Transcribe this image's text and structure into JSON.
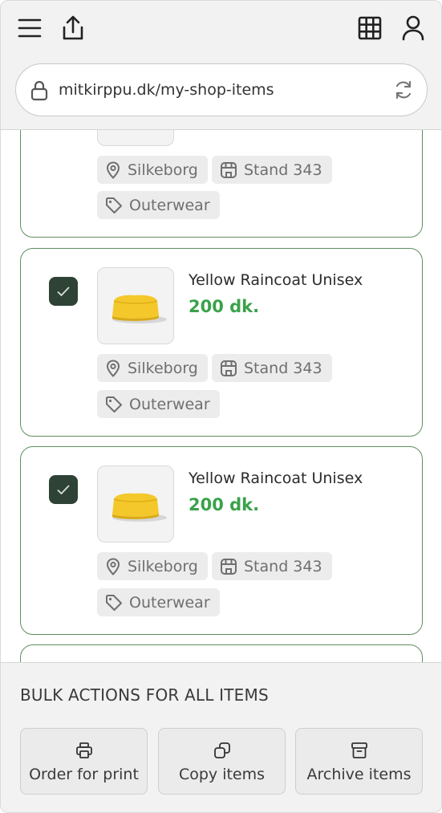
{
  "browser": {
    "url": "mitkirppu.dk/my-shop-items",
    "icons": [
      "menu-icon",
      "share-icon",
      "grid-icon",
      "user-icon",
      "lock-icon",
      "reload-icon"
    ]
  },
  "items": [
    {
      "title": "",
      "price": "",
      "location": "Silkeborg",
      "stand": "Stand 343",
      "category": "Outerwear",
      "checked": false
    },
    {
      "title": "Yellow Raincoat Unisex",
      "price": "200 dk.",
      "location": "Silkeborg",
      "stand": "Stand 343",
      "category": "Outerwear",
      "checked": true
    },
    {
      "title": "Yellow Raincoat Unisex",
      "price": "200 dk.",
      "location": "Silkeborg",
      "stand": "Stand 343",
      "category": "Outerwear",
      "checked": true
    }
  ],
  "bulk": {
    "heading": "BULK ACTIONS FOR ALL ITEMS",
    "actions": [
      {
        "label": "Order for print",
        "icon": "printer-icon"
      },
      {
        "label": "Copy items",
        "icon": "copy-icon"
      },
      {
        "label": "Archive items",
        "icon": "archive-icon"
      }
    ]
  },
  "colors": {
    "accent_green": "#3aa24a",
    "card_border": "#5e8f61",
    "checkbox": "#2e4236",
    "chip_bg": "#ececec"
  }
}
